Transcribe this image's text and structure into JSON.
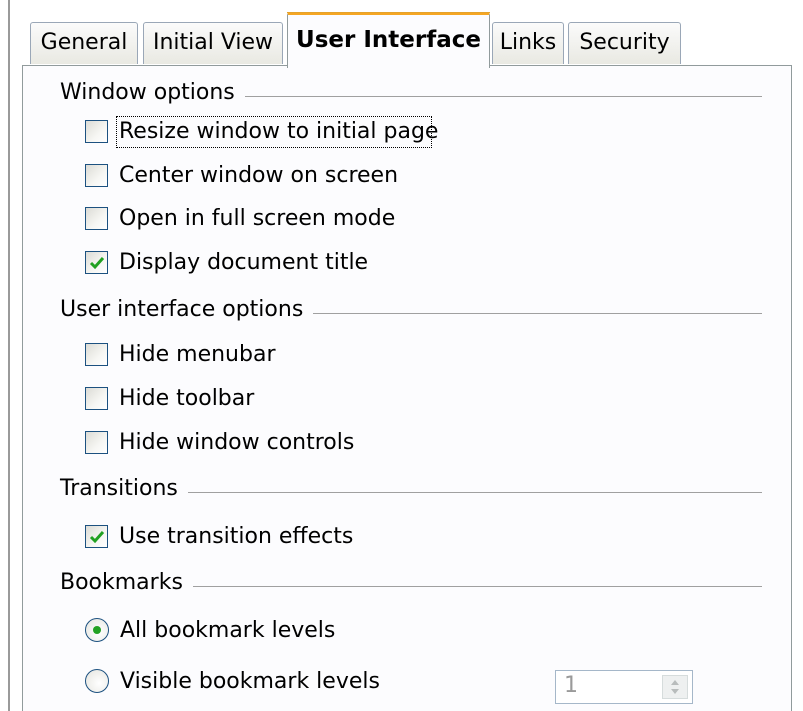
{
  "tabs": [
    {
      "label": "General",
      "active": false
    },
    {
      "label": "Initial View",
      "active": false
    },
    {
      "label": "User Interface",
      "active": true
    },
    {
      "label": "Links",
      "active": false
    },
    {
      "label": "Security",
      "active": false
    }
  ],
  "sections": {
    "window_options": {
      "title": "Window options",
      "items": [
        {
          "label": "Resize window to initial page",
          "checked": false,
          "focused": true
        },
        {
          "label": "Center window on screen",
          "checked": false
        },
        {
          "label": "Open in full screen mode",
          "checked": false
        },
        {
          "label": "Display document title",
          "checked": true
        }
      ]
    },
    "user_interface_options": {
      "title": "User interface options",
      "items": [
        {
          "label": "Hide menubar",
          "checked": false
        },
        {
          "label": "Hide toolbar",
          "checked": false
        },
        {
          "label": "Hide window controls",
          "checked": false
        }
      ]
    },
    "transitions": {
      "title": "Transitions",
      "items": [
        {
          "label": "Use transition effects",
          "checked": true
        }
      ]
    },
    "bookmarks": {
      "title": "Bookmarks",
      "items": [
        {
          "label": "All bookmark levels",
          "selected": true
        },
        {
          "label": "Visible bookmark levels",
          "selected": false
        }
      ],
      "level_value": "1"
    }
  },
  "colors": {
    "active_tab_accent": "#f5a623",
    "check_mark": "#21a121",
    "control_border": "#1c5180"
  }
}
